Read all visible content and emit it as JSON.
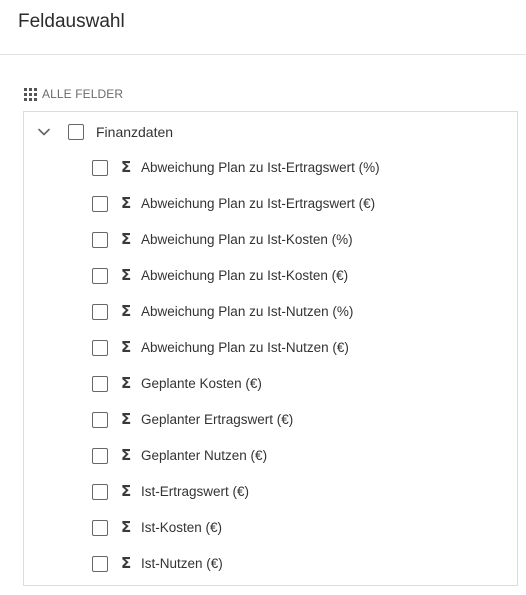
{
  "header": {
    "title": "Feldauswahl"
  },
  "section": {
    "label": "ALLE FELDER",
    "icon": "grid-icon"
  },
  "tree": {
    "parent": {
      "label": "Finanzdaten",
      "expanded": true,
      "checked": false
    },
    "children": [
      {
        "label": "Abweichung Plan zu Ist-Ertragswert (%)",
        "icon": "sigma-icon",
        "checked": false
      },
      {
        "label": "Abweichung Plan zu Ist-Ertragswert (€)",
        "icon": "sigma-icon",
        "checked": false
      },
      {
        "label": "Abweichung Plan zu Ist-Kosten (%)",
        "icon": "sigma-icon",
        "checked": false
      },
      {
        "label": "Abweichung Plan zu Ist-Kosten (€)",
        "icon": "sigma-icon",
        "checked": false
      },
      {
        "label": "Abweichung Plan zu Ist-Nutzen (%)",
        "icon": "sigma-icon",
        "checked": false
      },
      {
        "label": "Abweichung Plan zu Ist-Nutzen (€)",
        "icon": "sigma-icon",
        "checked": false
      },
      {
        "label": "Geplante Kosten (€)",
        "icon": "sigma-icon",
        "checked": false
      },
      {
        "label": "Geplanter Ertragswert (€)",
        "icon": "sigma-icon",
        "checked": false
      },
      {
        "label": "Geplanter Nutzen (€)",
        "icon": "sigma-icon",
        "checked": false
      },
      {
        "label": "Ist-Ertragswert (€)",
        "icon": "sigma-icon",
        "checked": false
      },
      {
        "label": "Ist-Kosten (€)",
        "icon": "sigma-icon",
        "checked": false
      },
      {
        "label": "Ist-Nutzen (€)",
        "icon": "sigma-icon",
        "checked": false
      }
    ]
  }
}
